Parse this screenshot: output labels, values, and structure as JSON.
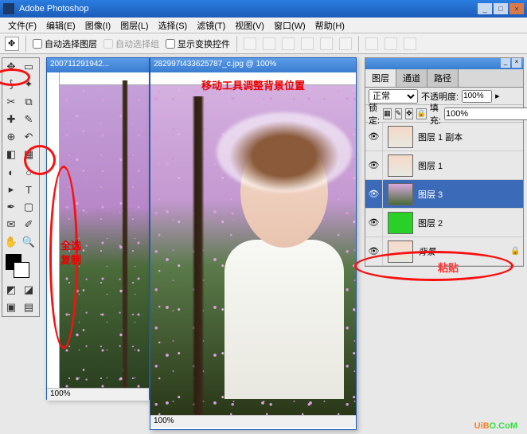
{
  "title": "Adobe Photoshop",
  "menu": [
    "文件(F)",
    "编辑(E)",
    "图像(I)",
    "图层(L)",
    "选择(S)",
    "滤镜(T)",
    "视图(V)",
    "窗口(W)",
    "帮助(H)"
  ],
  "opt": {
    "autoLayer": "自动选择图层",
    "autoGroup": "自动选择组",
    "transform": "显示变换控件"
  },
  "doc1": {
    "title": "200711291942...",
    "zoom": "100%"
  },
  "doc2": {
    "title": "282997t433625787_c.jpg @ 100%",
    "zoom": "100%",
    "label": "移动工具调整背景位置"
  },
  "panel": {
    "tabs": [
      "图层",
      "通道",
      "路径"
    ],
    "blend": "正常",
    "opacityLabel": "不透明度:",
    "opacity": "100%",
    "lockLabel": "锁定:",
    "fillLabel": "填充:",
    "fill": "100%",
    "layers": [
      {
        "name": "图层 1 副本",
        "thumb": "p"
      },
      {
        "name": "图层 1",
        "thumb": "p"
      },
      {
        "name": "图层 3",
        "thumb": "f",
        "sel": true
      },
      {
        "name": "图层 2",
        "thumb": "g"
      },
      {
        "name": "背景",
        "thumb": "p",
        "locked": true,
        "italic": true
      }
    ]
  },
  "anno": {
    "selectAll": "全选",
    "copy": "复制",
    "paste": "粘贴"
  },
  "watermark": {
    "a": "UiB",
    "b": "O.CoM"
  }
}
